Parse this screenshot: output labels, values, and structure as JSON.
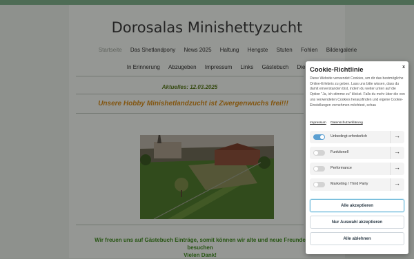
{
  "site": {
    "title": "Dorosalas Minishettyzucht"
  },
  "nav": {
    "row1": [
      "Startseite",
      "Das Shetlandpony",
      "News 2025",
      "Haltung",
      "Hengste",
      "Stuten",
      "Fohlen",
      "Bildergalerie"
    ],
    "row2": [
      "In Erinnerung",
      "Abzugeben",
      "Impressum",
      "Links",
      "Gästebuch",
      "Die Fellfarben"
    ],
    "active": "Startseite"
  },
  "main": {
    "news_date": "Aktuelles: 12.03.2025",
    "headline": "Unsere Hobby Minishetlandzucht ist Zwergenwuchs frei!!!",
    "guestbook_line1": "Wir freuen uns auf Gästebuch Einträge, somit können wir alte und neue Freunde besuchen",
    "guestbook_line2": "Vielen Dank!"
  },
  "cookie": {
    "title": "Cookie-Richtlinie",
    "close": "x",
    "text": "Diese Website verwendet Cookies, um dir das bestmögliche Online-Erlebnis zu geben. Lass uns bitte wissen, dass du damit einverstanden bist, indem du weiter unten auf die Option \"Ja, ich stimme zu\" klickst. Falls du mehr über die von uns verwendeten Cookies herausfinden und eigene Cookie-Einstellungen vornehmen möchtest, schau",
    "links": [
      "Impressum",
      "Datenschutzerklärung"
    ],
    "options": [
      {
        "label": "Unbedingt erforderlich",
        "on": true
      },
      {
        "label": "Funktionell",
        "on": false
      },
      {
        "label": "Performance",
        "on": false
      },
      {
        "label": "Marketing / Third Party",
        "on": false
      }
    ],
    "arrow": "→",
    "accept_all": "Alle akzeptieren",
    "accept_selection": "Nur Auswahl akzeptieren",
    "reject_all": "Alle ablehnen"
  },
  "colors": {
    "accent": "#7fae8a",
    "headline": "#d28a1a",
    "date": "#5a7a1f",
    "toggle_on": "#5b9fd1"
  }
}
